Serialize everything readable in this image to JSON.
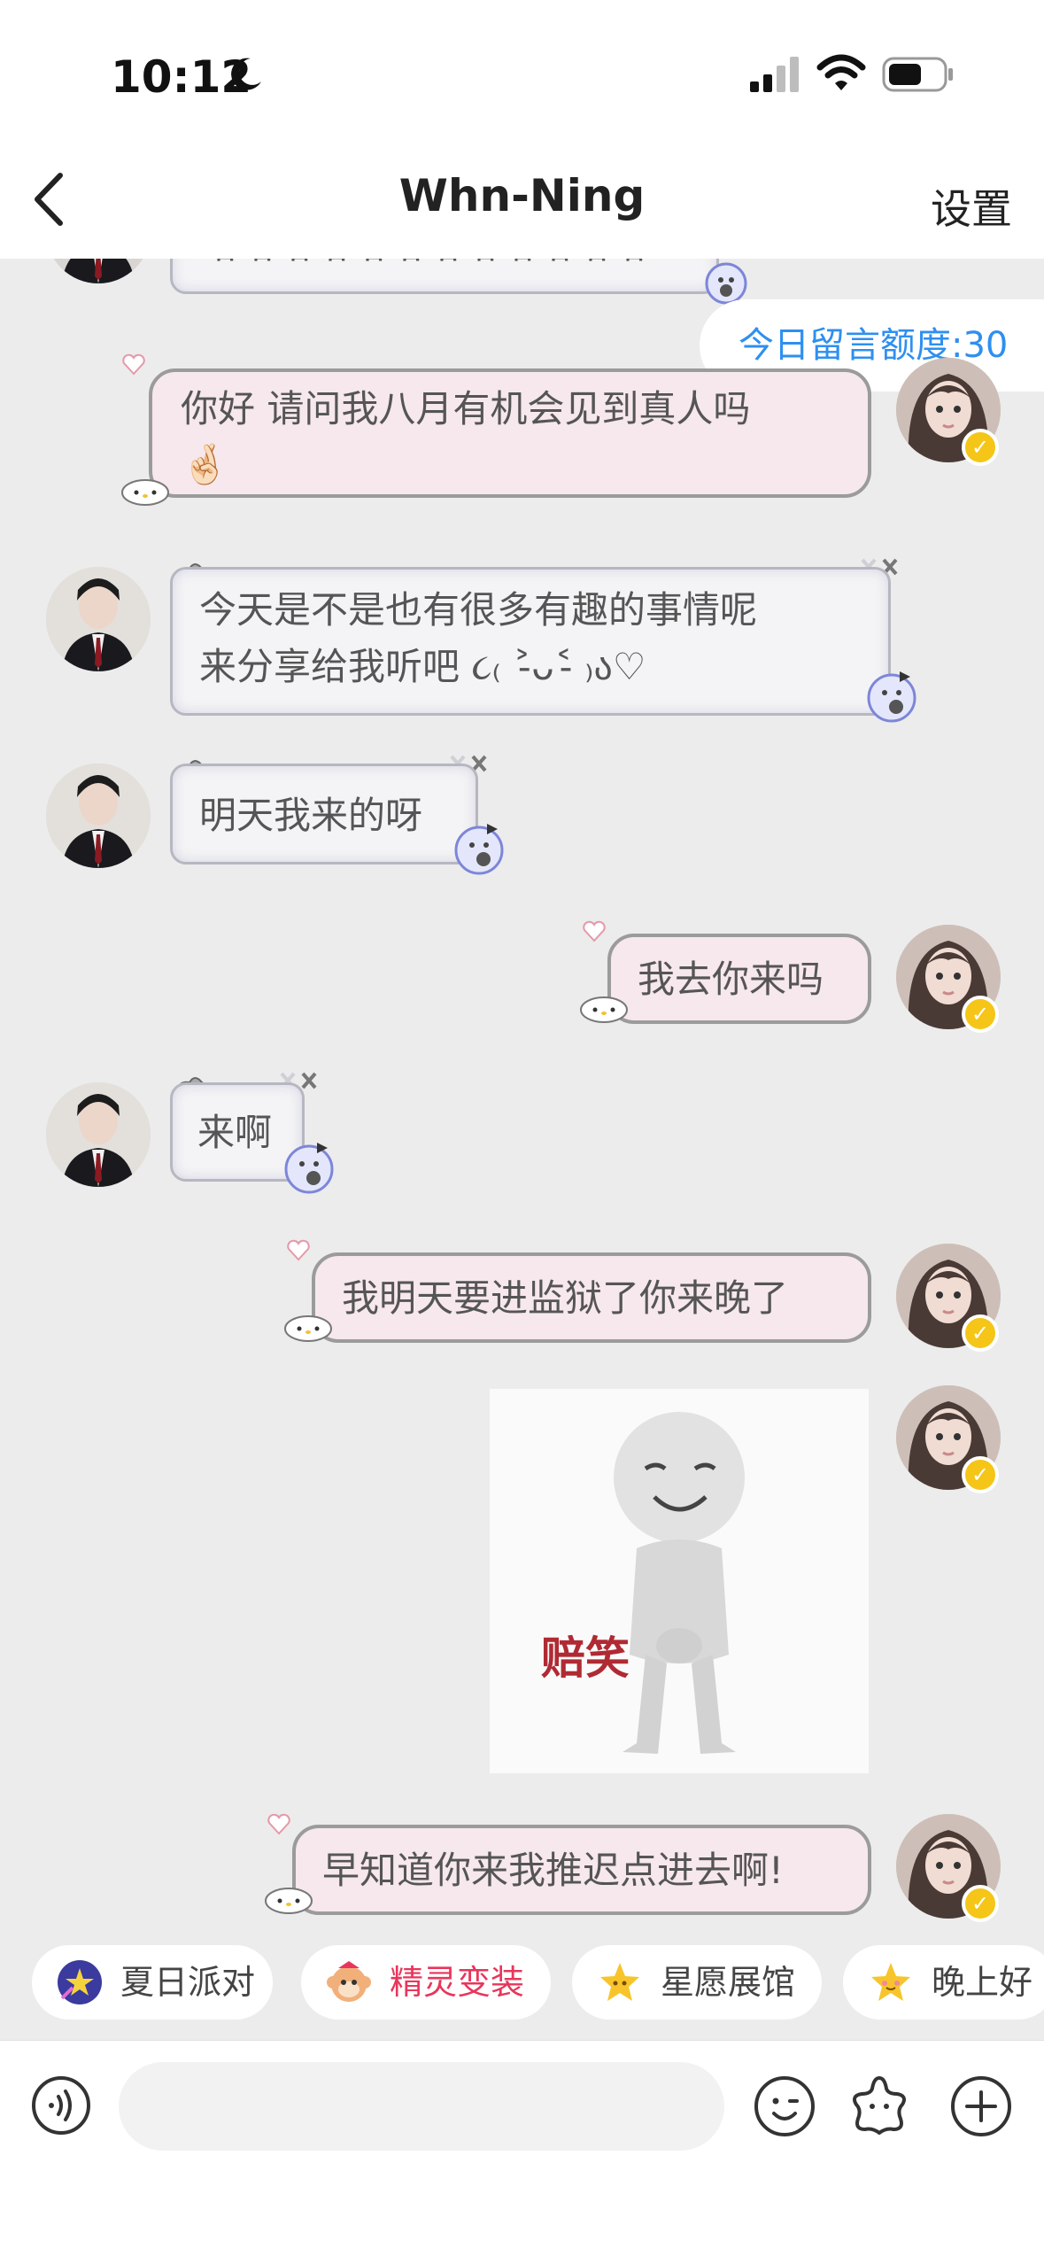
{
  "status_bar": {
    "time": "10:12"
  },
  "header": {
    "title": "Whn-Ning",
    "settings_label": "设置"
  },
  "quota_label": "今日留言额度:30",
  "messages": [
    {
      "side": "received",
      "type": "text",
      "text": "哈哈哈哈哈哈哈哈哈哈哈哈"
    },
    {
      "side": "sent",
      "type": "text",
      "text": "你好 请问我八月有机会见到真人吗",
      "emoji": "🤞🏻"
    },
    {
      "side": "received",
      "type": "text",
      "line1": "今天是不是也有很多有趣的事情呢",
      "line2": "来分享给我听吧 ૮₍ ˃̵ᴗ˂̵ ₎ა♡"
    },
    {
      "side": "received",
      "type": "text",
      "text": "明天我来的呀"
    },
    {
      "side": "sent",
      "type": "text",
      "text": "我去你来吗"
    },
    {
      "side": "received",
      "type": "text",
      "text": "来啊"
    },
    {
      "side": "sent",
      "type": "text",
      "text": "我明天要进监狱了你来晚了"
    },
    {
      "side": "sent",
      "type": "sticker",
      "caption": "赔笑"
    },
    {
      "side": "sent",
      "type": "text",
      "text": "早知道你来我推迟点进去啊!"
    }
  ],
  "quick_chips": [
    {
      "label": "夏日派对",
      "icon": "shooting-star-icon",
      "color": "#444444"
    },
    {
      "label": "精灵变装",
      "icon": "monkey-sprite-icon",
      "color": "#e8365b"
    },
    {
      "label": "星愿展馆",
      "icon": "star-icon",
      "color": "#444444"
    },
    {
      "label": "晚上好",
      "icon": "smiling-star-icon",
      "color": "#444444"
    }
  ],
  "input": {
    "placeholder": ""
  },
  "colors": {
    "accent": "#2e8ff0",
    "sent_bubble": "#f6e8ec",
    "received_bubble": "#f4f4f6",
    "verified": "#f5c518"
  }
}
